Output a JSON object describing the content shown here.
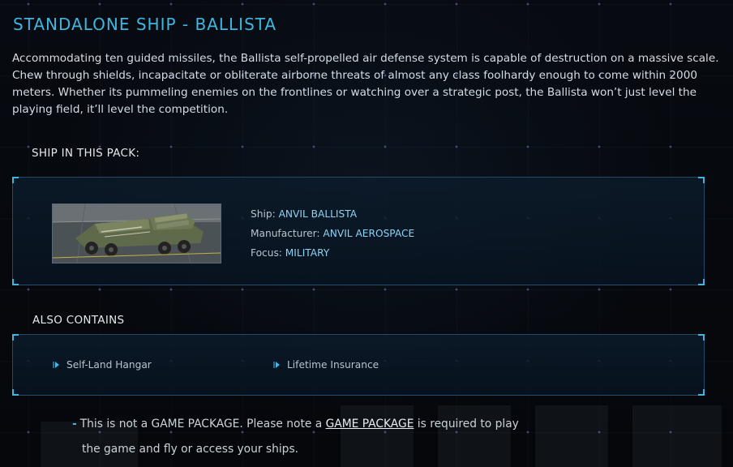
{
  "title": "STANDALONE SHIP - BALLISTA",
  "description": "Accommodating ten guided missiles, the Ballista self-propelled air defense system is capable of destruction on a massive scale. Chew through shields, incapacitate or obliterate airborne threats of almost any class foolhardy enough to come within 2000 meters. Whether its pummeling enemies on the frontlines or watching over a strategic post, the Ballista won’t just level the playing field, it’ll level the competition.",
  "ship_section": {
    "heading": "SHIP IN THIS PACK:",
    "ship_label": "Ship:",
    "ship_value": "ANVIL BALLISTA",
    "manufacturer_label": "Manufacturer:",
    "manufacturer_value": "ANVIL AEROSPACE",
    "focus_label": "Focus:",
    "focus_value": "MILITARY"
  },
  "contains_section": {
    "heading": "ALSO CONTAINS",
    "items": [
      {
        "label": "Self-Land Hangar"
      },
      {
        "label": "Lifetime Insurance"
      }
    ]
  },
  "notice": {
    "dash": "-",
    "text_before": "This is not a GAME PACKAGE. Please note a ",
    "link_text": "GAME PACKAGE",
    "text_after": " is required to play",
    "line2": "the game and fly or access your ships."
  },
  "colors": {
    "accent": "#3fb6e0",
    "value_text": "#8fd2f2",
    "background": "#05070b"
  }
}
